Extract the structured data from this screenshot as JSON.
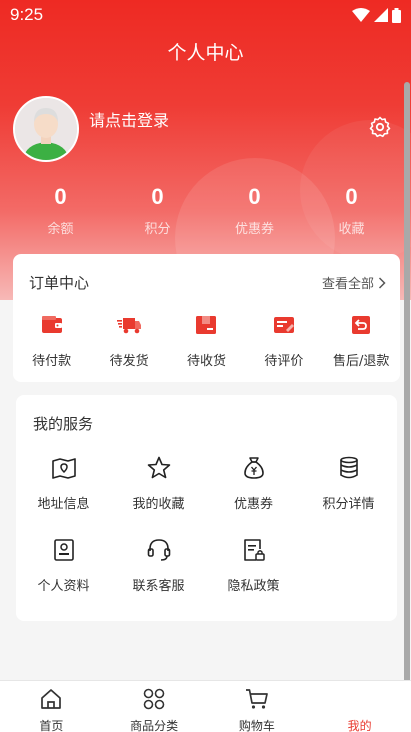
{
  "status": {
    "time": "9:25"
  },
  "header": {
    "title": "个人中心"
  },
  "profile": {
    "login_prompt": "请点击登录"
  },
  "stats": [
    {
      "value": "0",
      "label": "余额"
    },
    {
      "value": "0",
      "label": "积分"
    },
    {
      "value": "0",
      "label": "优惠券"
    },
    {
      "value": "0",
      "label": "收藏"
    }
  ],
  "orders": {
    "title": "订单中心",
    "view_all": "查看全部",
    "items": [
      {
        "label": "待付款",
        "icon": "wallet-icon"
      },
      {
        "label": "待发货",
        "icon": "truck-icon"
      },
      {
        "label": "待收货",
        "icon": "package-icon"
      },
      {
        "label": "待评价",
        "icon": "review-icon"
      },
      {
        "label": "售后/退款",
        "icon": "refund-icon"
      }
    ]
  },
  "services": {
    "title": "我的服务",
    "items": [
      {
        "label": "地址信息",
        "icon": "map-icon"
      },
      {
        "label": "我的收藏",
        "icon": "star-icon"
      },
      {
        "label": "优惠券",
        "icon": "money-bag-icon"
      },
      {
        "label": "积分详情",
        "icon": "coins-icon"
      },
      {
        "label": "个人资料",
        "icon": "profile-card-icon"
      },
      {
        "label": "联系客服",
        "icon": "headset-icon"
      },
      {
        "label": "隐私政策",
        "icon": "privacy-doc-icon"
      }
    ]
  },
  "tabbar": [
    {
      "label": "首页",
      "icon": "home-icon"
    },
    {
      "label": "商品分类",
      "icon": "category-grid-icon"
    },
    {
      "label": "购物车",
      "icon": "cart-icon"
    },
    {
      "label": "我的",
      "icon": "user-icon",
      "active": true
    }
  ],
  "colors": {
    "accent": "#ee2a23",
    "active_tab": "#e93a2f"
  }
}
